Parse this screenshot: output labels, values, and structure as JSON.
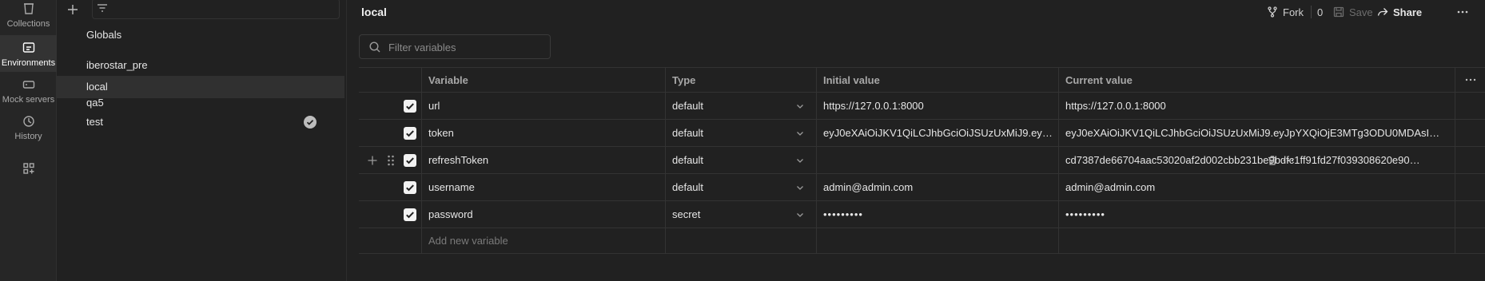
{
  "rail": {
    "items": [
      {
        "label": "Collections",
        "icon": "collections-icon"
      },
      {
        "label": "Environments",
        "icon": "environments-icon"
      },
      {
        "label": "Mock servers",
        "icon": "mock-servers-icon"
      },
      {
        "label": "History",
        "icon": "history-icon"
      },
      {
        "label": "",
        "icon": "configure-workbench-icon"
      }
    ]
  },
  "envlist": {
    "globals": "Globals",
    "items": [
      {
        "label": "iberostar_pre"
      },
      {
        "label": "local"
      },
      {
        "label": "qa5"
      },
      {
        "label": "test"
      }
    ]
  },
  "main": {
    "title": "local",
    "fork_label": "Fork",
    "fork_count": "0",
    "save_label": "Save",
    "share_label": "Share",
    "filter_placeholder": "Filter variables"
  },
  "table": {
    "headers": {
      "variable": "Variable",
      "type": "Type",
      "initial": "Initial value",
      "current": "Current value"
    },
    "rows": [
      {
        "variable": "url",
        "type": "default",
        "initial": "https://127.0.0.1:8000",
        "current": "https://127.0.0.1:8000"
      },
      {
        "variable": "token",
        "type": "default",
        "initial": "eyJ0eXAiOiJKV1QiLCJhbGciOiJSUzUxMiJ9.eyJp...",
        "current": "eyJ0eXAiOiJKV1QiLCJhbGciOiJSUzUxMiJ9.eyJpYXQiOjE3MTg3ODU0MDAsImV4..."
      },
      {
        "variable": "refreshToken",
        "type": "default",
        "initial": "",
        "current": "cd7387de66704aac53020af2d002cbb231be9bdfc1ff91fd27f039308620e90efc..."
      },
      {
        "variable": "username",
        "type": "default",
        "initial": "admin@admin.com",
        "current": "admin@admin.com"
      },
      {
        "variable": "password",
        "type": "secret",
        "initial": "•••••••••",
        "current": "•••••••••"
      }
    ],
    "add_new_placeholder": "Add new variable"
  },
  "colors": {
    "background": "#212121",
    "rail": "#262626",
    "selected": "#303030",
    "border": "#333333",
    "text": "#e6e6e6"
  }
}
